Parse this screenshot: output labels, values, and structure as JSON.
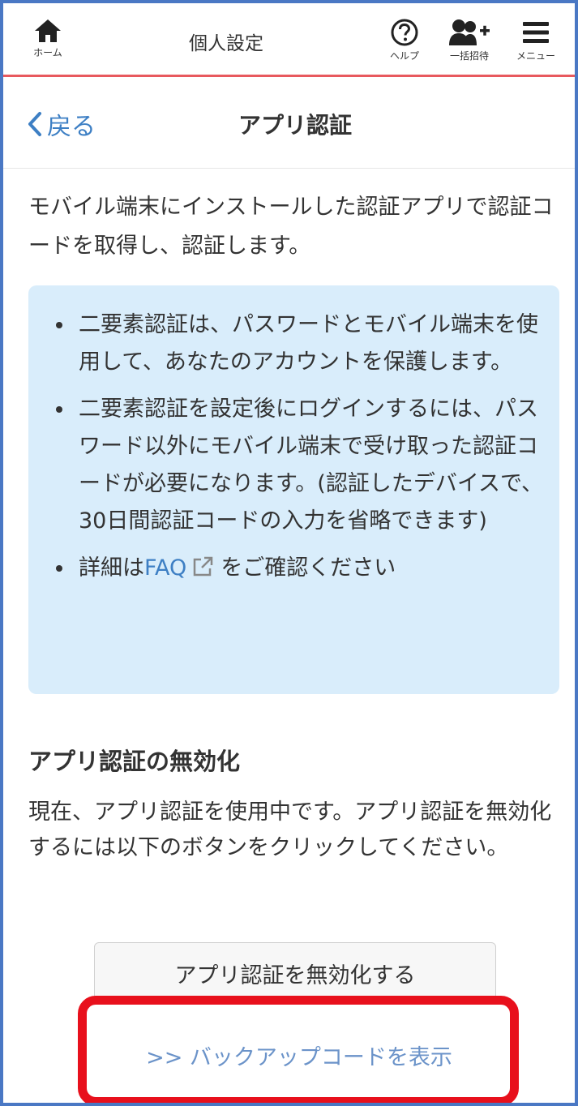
{
  "nav": {
    "home_label": "ホーム",
    "title": "個人設定",
    "help_label": "ヘルプ",
    "invite_label": "一括招待",
    "menu_label": "メニュー"
  },
  "header": {
    "back_label": "戻る",
    "title": "アプリ認証"
  },
  "intro": "モバイル端末にインストールした認証アプリで認証コードを取得し、認証します。",
  "info": {
    "items": [
      "二要素認証は、パスワードとモバイル端末を使用して、あなたのアカウントを保護します。",
      "二要素認証を設定後にログインするには、パスワード以外にモバイル端末で受け取った認証コードが必要になります。(認証したデバイスで、30日間認証コードの入力を省略できます)"
    ],
    "faq_prefix": "詳細は",
    "faq_link": "FAQ",
    "faq_suffix": "をご確認ください"
  },
  "disable_section": {
    "heading": "アプリ認証の無効化",
    "body": "現在、アプリ認証を使用中です。アプリ認証を無効化するには以下のボタンをクリックしてください。",
    "button_label": "アプリ認証を無効化する"
  },
  "backup_link": ">> バックアップコードを表示",
  "colors": {
    "accent": "#3d7fc4",
    "nav_border": "#e8595e",
    "frame_border": "#4a78c4",
    "info_bg": "#d9edfb",
    "highlight": "#e8101c"
  },
  "icons": [
    "home-icon",
    "help-icon",
    "invite-users-icon",
    "menu-icon",
    "chevron-left-icon",
    "external-link-icon"
  ]
}
